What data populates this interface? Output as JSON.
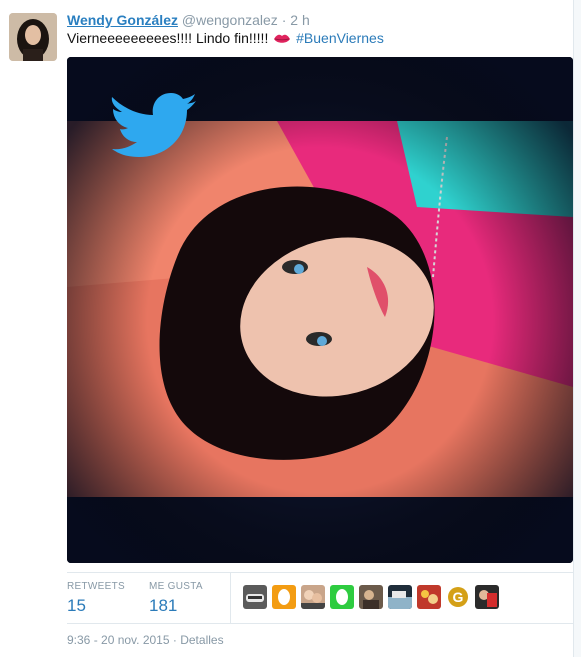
{
  "tweet": {
    "author_name": "Wendy González",
    "handle": "@wengonzalez",
    "separator": "·",
    "time_ago": "2 h",
    "text": "Vierneeeeeeeees!!!! Lindo fin!!!!!",
    "emoji_icon": "kiss-lips-icon",
    "hashtag": "#BuenViernes"
  },
  "stats": {
    "retweets_label": "RETWEETS",
    "retweets_value": "15",
    "likes_label": "ME GUSTA",
    "likes_value": "181"
  },
  "footer": {
    "timestamp": "9:36 - 20 nov. 2015",
    "separator": "·",
    "details_label": "Detalles"
  },
  "colors": {
    "name_link": "#2a7fc0",
    "hashtag": "#2b7bb9",
    "muted": "#8899a6",
    "twitter_bird": "#2ea8ef"
  }
}
